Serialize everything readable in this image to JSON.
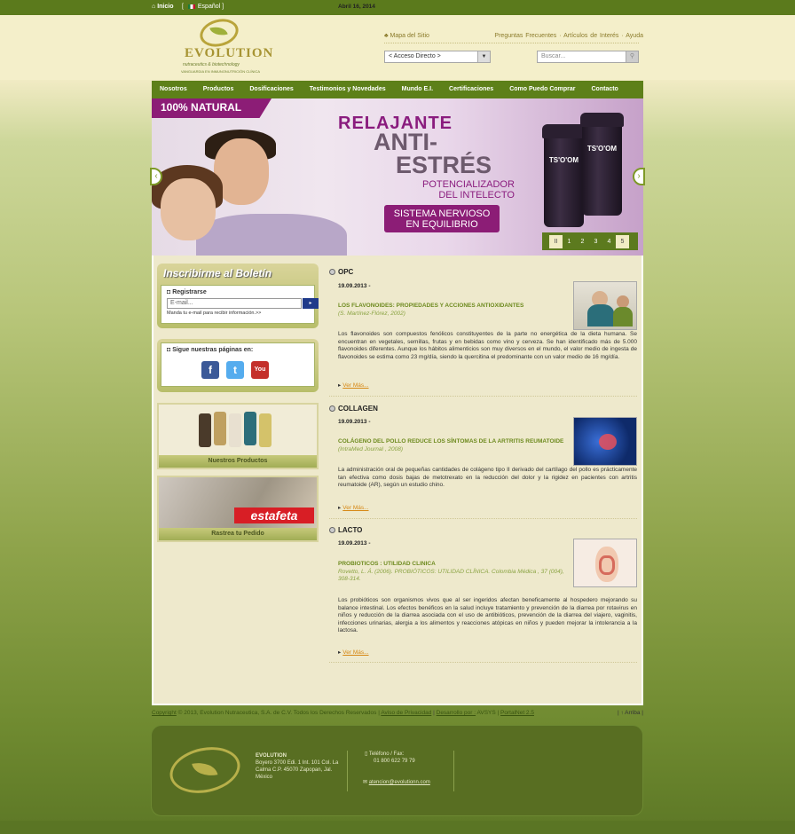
{
  "topbar": {
    "home": "Inicio",
    "language": "Español",
    "date": "Abril 16, 2014"
  },
  "header": {
    "logo_name": "EVOLUTION",
    "logo_sub": "nutraceutics & biotechnology",
    "logo_tag": "VANGUARDIA EN INMUNONUTRICIÓN CLÍNICA",
    "sitemap": "Mapa del Sitio",
    "links": "Preguntas Frecuentes · Artículos de Interés · Ayuda",
    "quick_access": "< Acceso Directo >",
    "search_placeholder": "Buscar..."
  },
  "nav": [
    "Nosotros",
    "Productos",
    "Dosificaciones",
    "Testimonios y Novedades",
    "Mundo E.I.",
    "Certificaciones",
    "Como Puedo Comprar",
    "Contacto"
  ],
  "banner": {
    "badge": "100% NATURAL",
    "l1": "RELAJANTE",
    "l2a": "ANTI-",
    "l2b": "ESTRÉS",
    "l3a": "POTENCIALIZADOR",
    "l3b": "DEL INTELECTO",
    "l4a": "SISTEMA NERVIOSO",
    "l4b": "EN EQUILIBRIO",
    "jar": "TS'O'OM",
    "pages": [
      "II",
      "1",
      "2",
      "3",
      "4",
      "5"
    ],
    "active_page": "5"
  },
  "sidebar": {
    "newsletter_title": "Inscribirme al Boletín",
    "register": "Registrarse",
    "email_placeholder": "E-mail...",
    "email_hint": "Manda tu e-mail para recibir información.>>",
    "social_title": "Sigue nuestras páginas en:",
    "products_caption": "Nuestros Productos",
    "estafeta_label": "estafeta",
    "track_caption": "Rastrea tu Pedido"
  },
  "sections": [
    {
      "heading": "OPC",
      "date": "19.09.2013 -",
      "title": "LOS FLAVONOIDES: PROPIEDADES Y ACCIONES ANTIOXIDANTES",
      "ref": "(S. Martínez-Flórez, 2002)",
      "text": "Los flavonoides son compuestos fenólicos constituyentes de la parte no energética de la dieta humana. Se encuentran en vegetales, semillas, frutas y en bebidas como vino y cerveza. Se han identificado más de 5.000 flavonoides diferentes. Aunque los hábitos alimenticios son muy diversos en el mundo, el valor medio de ingesta de flavonoides se estima como 23 mg/día, siendo la quercitina el predominante con un valor medio de 16 mg/día.",
      "more": "Ver Más..."
    },
    {
      "heading": "COLLAGEN",
      "date": "19.09.2013 -",
      "title": "COLÁGENO DEL POLLO REDUCE LOS SÍNTOMAS DE LA ARTRITIS REUMATOIDE",
      "ref": "(IntraMed Journal , 2008)",
      "text": "La administración oral de pequeñas cantidades de colágeno tipo II derivado del cartílago del pollo es prácticamente tan efectiva como dosis bajas de metotrexato en la reducción del dolor y la rigidez en pacientes con artritis reumatoide (AR), según un estudio chino.",
      "more": "Ver Más..."
    },
    {
      "heading": "LACTO",
      "date": "19.09.2013 -",
      "title": "PROBIOTICOS : UTILIDAD CLINICA",
      "ref": "Rovetto, L. Á. (2006). PROBIÓTICOS: UTILIDAD CLÍNICA. Colombia Médica , 37 (004), 308-314.",
      "text": "Los probióticos son organismos vivos que al ser ingeridos afectan beneficamente al hospedero mejorando su balance intestinal. Los efectos benéficos en la salud incluye tratamiento y prevención de la diarrea por rotavirus en niños y reducción de la diarrea asociada con el uso de antibióticos, prevención de la diarrea del viajero, vaginitis, infecciones urinarias, alergia a los alimentos y reacciones atópicas en niños y pueden mejorar la intolerancia a la lactosa.",
      "more": "Ver Más..."
    }
  ],
  "footer": {
    "copyright": "Copyright",
    "copy_text": "© 2013, Evolution Nutraceutica, S.A. de C.V. Todos los Derechos Reservados |",
    "privacy": "Aviso de Privacidad",
    "dev": "Desarrollo por :",
    "dev_by": "AVSYS |",
    "portalnet": "PortalNet 2.5",
    "top": "|  ↑  Arriba  |",
    "company": "EVOLUTION",
    "address": "Boyero 3700 Edi. 1 Int. 101 Col. La Calma C.P. 45070 Zapopan, Jal. México",
    "phone_label": "Teléfono / Fax:",
    "phone": "01 800 622 79 79",
    "email": "atencion@evolutionn.com"
  }
}
